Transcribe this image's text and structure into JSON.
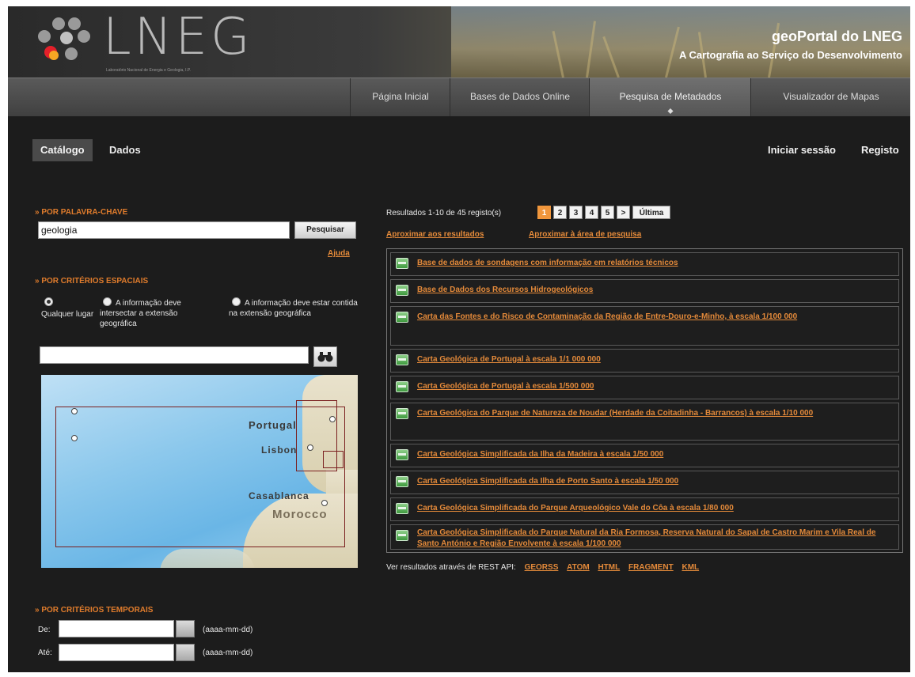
{
  "header": {
    "logo_text": "LNEG",
    "logo_subtitle": "Laboratório Nacional de Energia e Geologia, I.P.",
    "portal_title": "geoPortal do LNEG",
    "portal_subtitle": "A Cartografia ao Serviço do Desenvolvimento"
  },
  "nav": {
    "items": [
      {
        "label": "Página Inicial"
      },
      {
        "label": "Bases de Dados Online"
      },
      {
        "label": "Pesquisa de Metadados",
        "active": true
      },
      {
        "label": "Visualizador de Mapas"
      }
    ]
  },
  "tabs": {
    "catalogo": "Catálogo",
    "dados": "Dados"
  },
  "account": {
    "login": "Iniciar sessão",
    "register": "Registo"
  },
  "keyword": {
    "section": "Por palavra-chave",
    "value": "geologia",
    "search_button": "Pesquisar",
    "help": "Ajuda"
  },
  "spatial": {
    "section": "Por critérios espaciais",
    "options": [
      {
        "label": "Qualquer lugar",
        "selected": true
      },
      {
        "label": "A informação deve intersectar a extensão geográfica",
        "selected": false
      },
      {
        "label": "A informação deve estar contida na extensão geográfica",
        "selected": false
      }
    ],
    "place_value": "",
    "search_icon": "binoculars-icon",
    "map_labels": {
      "portugal": "Portugal",
      "lisbon": "Lisbon",
      "casablanca": "Casablanca",
      "morocco": "Morocco"
    }
  },
  "temporal": {
    "section": "Por critérios temporais",
    "from_label": "De:",
    "to_label": "Até:",
    "from_value": "",
    "to_value": "",
    "format_hint": "(aaaa-mm-dd)",
    "calendar_icon": "calendar-icon"
  },
  "results": {
    "summary": "Resultados 1-10 de 45 registo(s)",
    "pages": [
      "1",
      "2",
      "3",
      "4",
      "5",
      ">",
      "Última"
    ],
    "current_page": "1",
    "zoom_results": "Aproximar aos resultados",
    "zoom_area": "Aproximar à área de pesquisa",
    "items": [
      "Base de dados de sondagens com informação em relatórios técnicos",
      "Base de Dados dos Recursos Hidrogeológicos",
      "Carta das Fontes e do Risco de Contaminação da Região de Entre-Douro-e-Minho, à escala 1/100 000",
      "Carta Geológica de Portugal à escala 1/1 000 000",
      "Carta Geológica de Portugal à escala 1/500 000",
      "Carta Geológica do Parque de Natureza de Noudar (Herdade da Coitadinha - Barrancos) à escala 1/10 000",
      "Carta Geológica Simplificada da Ilha da Madeira à escala 1/50 000",
      "Carta Geológica Simplificada da Ilha de Porto Santo à escala 1/50 000",
      "Carta Geológica Simplificada do Parque Arqueológico Vale do Côa à escala 1/80 000",
      "Carta Geológica Simplificada do Parque Natural da Ria Formosa, Reserva Natural do Sapal de Castro Marim e Vila Real de Santo António e Região Envolvente à escala 1/100 000"
    ],
    "rest_label": "Ver resultados através de REST API:",
    "rest_links": [
      "GEORSS",
      "ATOM",
      "HTML",
      "FRAGMENT",
      "KML"
    ]
  }
}
